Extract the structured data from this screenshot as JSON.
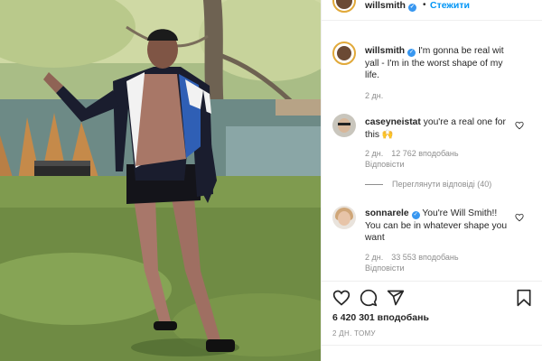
{
  "post": {
    "username": "willsmith",
    "follow_label": "Стежити",
    "separator": "•"
  },
  "caption": {
    "username": "willsmith",
    "text": "I'm gonna be real wit yall - I'm in the worst shape of my life.",
    "time": "2 дн."
  },
  "comments": [
    {
      "username": "caseyneistat",
      "text": "you're a real one for this 🙌",
      "time": "2 дн.",
      "likes": "12 762 вподобань",
      "reply_label": "Відповісти",
      "view_replies": "Переглянути відповіді (40)"
    },
    {
      "username": "sonnarele",
      "text": "You're Will Smith!! You can be in whatever shape you want",
      "time": "2 дн.",
      "likes": "33 553 вподобань",
      "reply_label": "Відповісти"
    }
  ],
  "actions": {
    "icons": [
      "heart-icon",
      "comment-icon",
      "share-icon",
      "bookmark-icon"
    ]
  },
  "likes_count": "6 420 301 вподобань",
  "posted_ago": "2 ДН. ТОМУ",
  "colors": {
    "link_blue": "#0095f6",
    "verified_blue": "#3897f0",
    "muted_gray": "#8e8e8e",
    "story_ring": "#e1a93a"
  }
}
